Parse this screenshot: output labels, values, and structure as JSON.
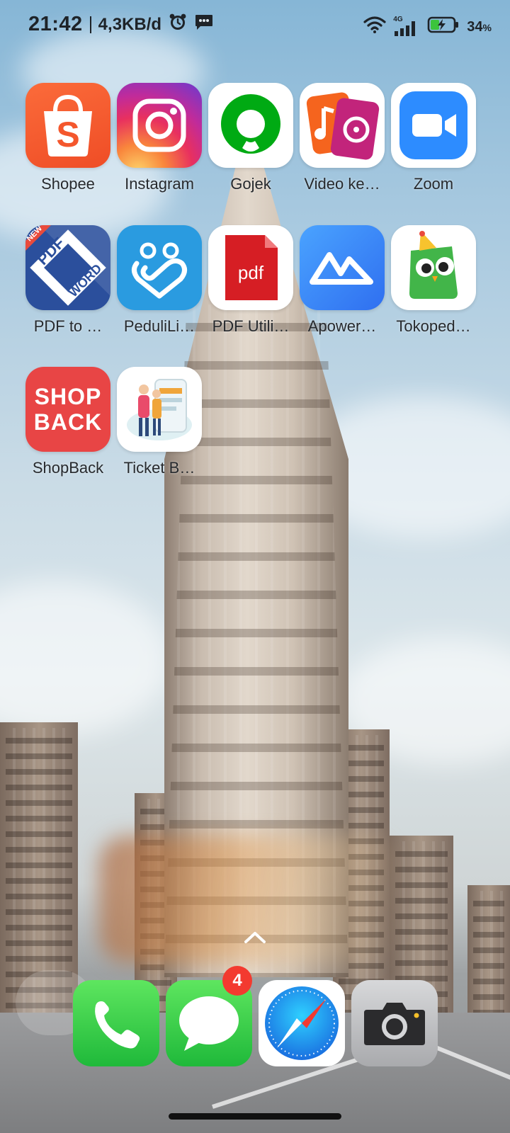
{
  "status_bar": {
    "time": "21:42",
    "network_speed": "4,3KB/d",
    "network_type": "4G",
    "battery_level": "34",
    "battery_unit": "%"
  },
  "apps": [
    {
      "label": "Shopee",
      "icon": "shopee-bag-icon"
    },
    {
      "label": "Instagram",
      "icon": "instagram-camera-icon"
    },
    {
      "label": "Gojek",
      "icon": "gojek-logo-icon"
    },
    {
      "label": "Video ke…",
      "icon": "music-video-icon"
    },
    {
      "label": "Zoom",
      "icon": "zoom-camera-icon"
    },
    {
      "label": "PDF to …",
      "icon": "pdf-to-word-icon",
      "icon_text": {
        "tag": "NEW",
        "top": "PDF",
        "bottom": "WORD"
      }
    },
    {
      "label": "PeduliLi…",
      "icon": "pedulilindungi-icon"
    },
    {
      "label": "PDF Utili…",
      "icon": "pdf-file-icon",
      "icon_text": "pdf"
    },
    {
      "label": "Apower…",
      "icon": "apowermirror-icon"
    },
    {
      "label": "Tokoped…",
      "icon": "tokopedia-owl-icon"
    },
    {
      "label": "ShopBack",
      "icon": "shopback-icon",
      "icon_text": {
        "line1": "SHOP",
        "line2": "BACK"
      }
    },
    {
      "label": "Ticket B…",
      "icon": "ticket-booking-icon"
    }
  ],
  "dock": {
    "phone": {
      "icon": "phone-icon"
    },
    "messages": {
      "icon": "messages-icon",
      "badge": "4"
    },
    "browser": {
      "icon": "safari-compass-icon"
    },
    "camera": {
      "icon": "camera-icon"
    }
  },
  "colors": {
    "shopee": "#f4572d",
    "gojek": "#00aa13",
    "zoom": "#2d8cff",
    "pdf_red": "#d61e24",
    "shopback": "#e84545",
    "tokopedia": "#42b549",
    "dock_green": "#3ecf4a"
  }
}
